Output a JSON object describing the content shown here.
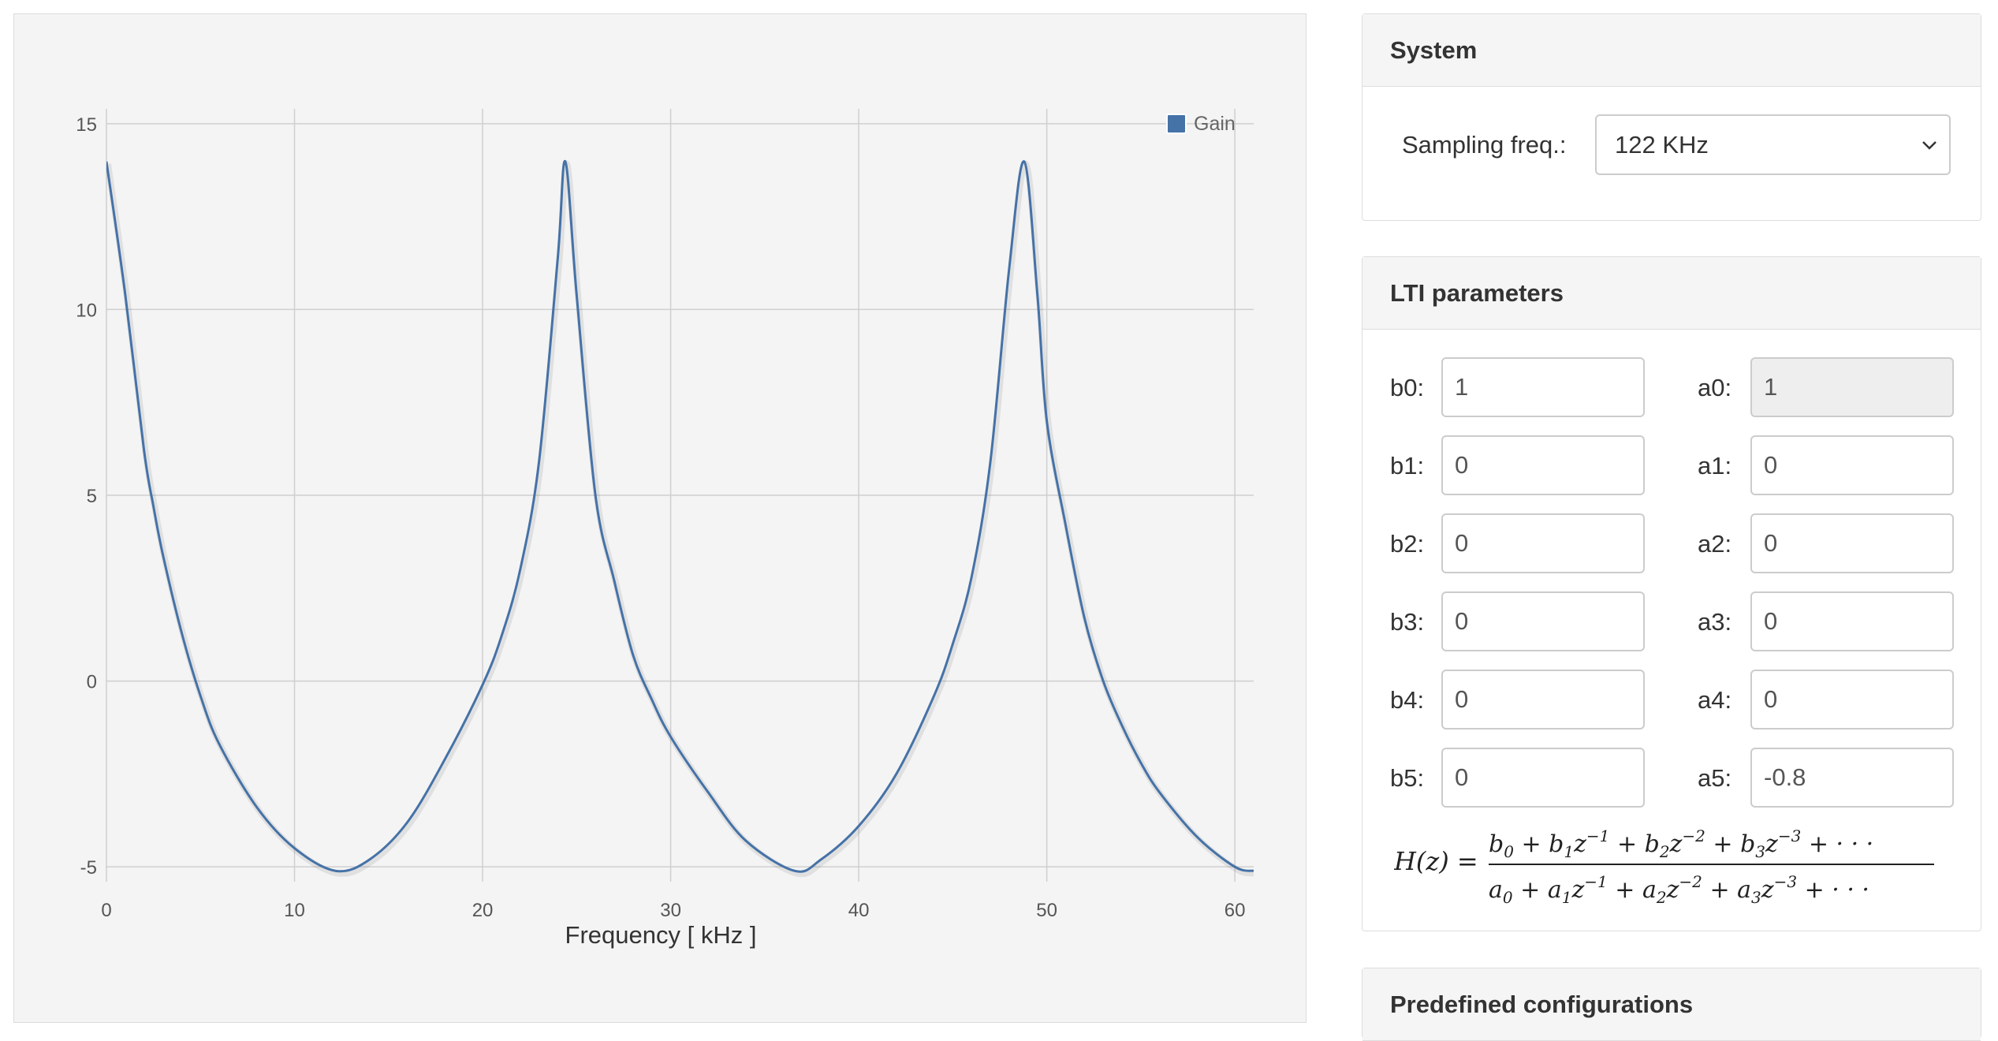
{
  "chart": {
    "legend_label": "Gain",
    "xlabel": "Frequency [ kHz ]",
    "series_color": "#4572a7"
  },
  "chart_data": {
    "type": "line",
    "xlabel": "Frequency [ kHz ]",
    "ylabel": "",
    "xlim": [
      0,
      61
    ],
    "ylim": [
      -5.4,
      15.4
    ],
    "x_ticks": [
      0,
      10,
      20,
      30,
      40,
      50,
      60
    ],
    "y_ticks": [
      -5,
      0,
      5,
      10,
      15
    ],
    "grid": true,
    "legend_position": "top-right",
    "series": [
      {
        "name": "Gain",
        "x": [
          0,
          1,
          2,
          2.5,
          3,
          4,
          5,
          6,
          8,
          10,
          12.2,
          14,
          16,
          18,
          20,
          21,
          22,
          23,
          24,
          24.4,
          25,
          26,
          27,
          28,
          29,
          30,
          32,
          34,
          36.6,
          38,
          40,
          42,
          44,
          45,
          46,
          47,
          48,
          48.8,
          49.5,
          50,
          51,
          52,
          53,
          54,
          55,
          56,
          58,
          60,
          61
        ],
        "y": [
          13.98,
          10.4,
          6.2,
          4.7,
          3.4,
          1.3,
          -0.4,
          -1.7,
          -3.4,
          -4.5,
          -5.11,
          -4.8,
          -3.8,
          -2.1,
          -0.1,
          1.2,
          3.0,
          5.9,
          11.4,
          13.98,
          10.4,
          5.0,
          2.7,
          0.7,
          -0.5,
          -1.5,
          -3.0,
          -4.3,
          -5.11,
          -4.8,
          -3.9,
          -2.5,
          -0.4,
          1.0,
          2.8,
          5.9,
          11.1,
          13.98,
          10.4,
          7.0,
          4.2,
          1.7,
          0.0,
          -1.2,
          -2.2,
          -3.0,
          -4.2,
          -5.0,
          -5.11
        ]
      }
    ]
  },
  "system": {
    "title": "System",
    "sampling_label": "Sampling freq.:",
    "sampling_value": "122 KHz"
  },
  "lti": {
    "title": "LTI parameters",
    "b_labels": [
      "b0:",
      "b1:",
      "b2:",
      "b3:",
      "b4:",
      "b5:"
    ],
    "b_values": [
      "1",
      "0",
      "0",
      "0",
      "0",
      "0"
    ],
    "a_labels": [
      "a0:",
      "a1:",
      "a2:",
      "a3:",
      "a4:",
      "a5:"
    ],
    "a_values": [
      "1",
      "0",
      "0",
      "0",
      "0",
      "-0.8"
    ]
  },
  "predefined": {
    "title": "Predefined configurations"
  }
}
